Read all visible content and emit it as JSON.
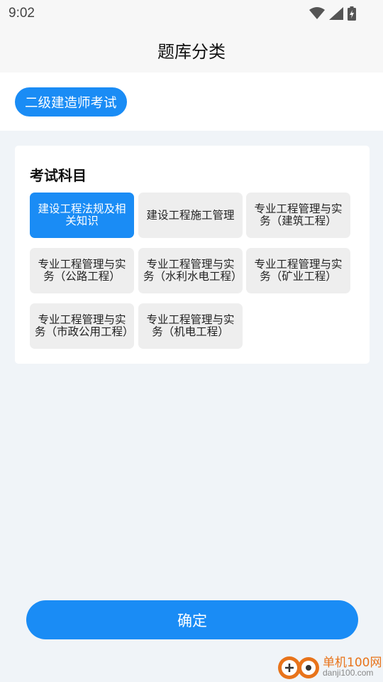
{
  "status_bar": {
    "time": "9:02",
    "icons": [
      "wifi-icon",
      "signal-icon",
      "battery-charging-icon"
    ]
  },
  "header": {
    "title": "题库分类"
  },
  "exam": {
    "selected_label": "二级建造师考试"
  },
  "subjects": {
    "heading": "考试科目",
    "items": [
      {
        "label": "建设工程法规及相关知识",
        "selected": true
      },
      {
        "label": "建设工程施工管理",
        "selected": false
      },
      {
        "label": "专业工程管理与实务（建筑工程）",
        "selected": false
      },
      {
        "label": "专业工程管理与实务（公路工程）",
        "selected": false
      },
      {
        "label": "专业工程管理与实务（水利水电工程）",
        "selected": false
      },
      {
        "label": "专业工程管理与实务（矿业工程）",
        "selected": false
      },
      {
        "label": "专业工程管理与实务（市政公用工程）",
        "selected": false
      },
      {
        "label": "专业工程管理与实务（机电工程）",
        "selected": false
      }
    ]
  },
  "footer": {
    "confirm_label": "确定"
  },
  "watermark": {
    "name": "单机100网",
    "url": "danji100.com"
  },
  "colors": {
    "accent": "#1a8cf5",
    "page_background": "#f0f4f8",
    "tile_background": "#eeeeee",
    "watermark_orange": "#e8731a"
  }
}
